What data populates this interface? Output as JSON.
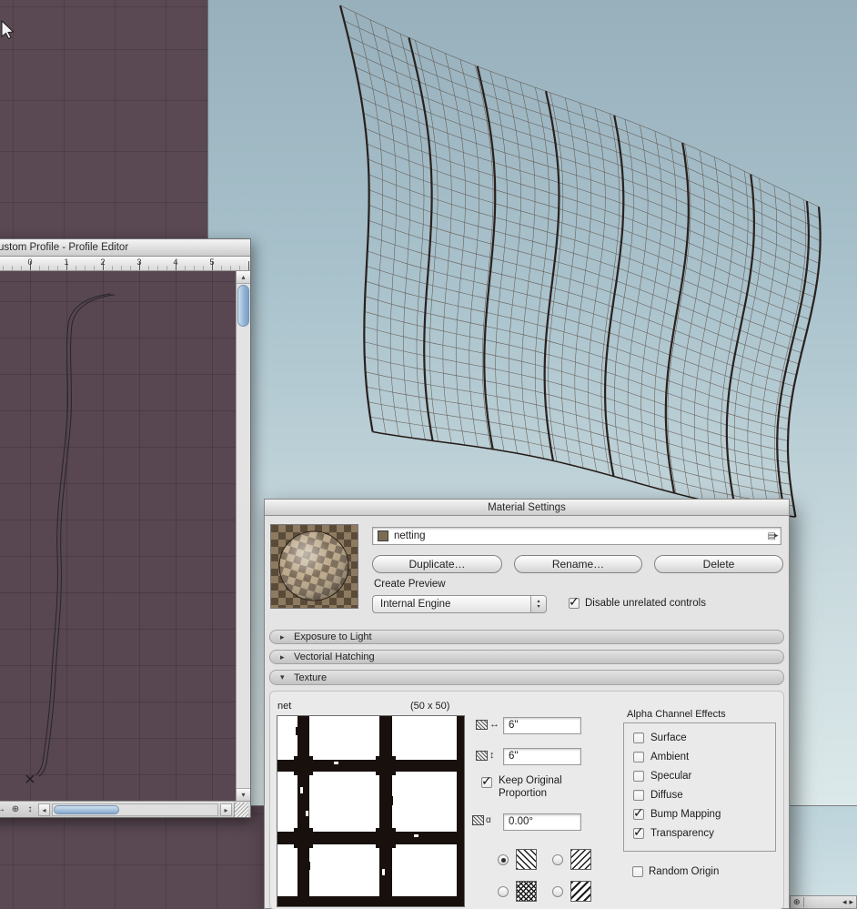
{
  "colors": {
    "workspace_bg": "#5a4852",
    "viewport_top": "#97b0bc",
    "viewport_bottom": "#dce9ea",
    "mesh_line": "#241a16",
    "dialog_bg": "#e4e4e4"
  },
  "icons": {
    "zoom_out": "⊖",
    "zoom_in": "⊕",
    "pan": "↔",
    "fit": "↕",
    "zoom": "⊕",
    "scroll_up": "▴",
    "scroll_down": "▾",
    "scroll_left": "◂",
    "scroll_right": "▸",
    "popup_up": "▴",
    "popup_down": "▾",
    "page": "▤",
    "more": "▸",
    "disclosure_collapsed": "▸",
    "disclosure_expanded": "▾"
  },
  "profile_editor": {
    "title": "ustom Profile - Profile Editor",
    "ruler": [
      "0",
      "1",
      "2",
      "3",
      "4",
      "5"
    ]
  },
  "material_settings": {
    "title": "Material Settings",
    "material_name": "netting",
    "duplicate_label": "Duplicate…",
    "rename_label": "Rename…",
    "delete_label": "Delete",
    "create_preview_label": "Create Preview",
    "engine_value": "Internal Engine",
    "disable_unrelated_label": "Disable unrelated controls",
    "disable_unrelated_checked": true,
    "sections": [
      {
        "label": "Exposure to Light",
        "expanded": false
      },
      {
        "label": "Vectorial Hatching",
        "expanded": false
      },
      {
        "label": "Texture",
        "expanded": true
      }
    ],
    "texture": {
      "file_name": "net",
      "dimensions": "(50 x 50)",
      "width_value": "6\"",
      "height_value": "6\"",
      "keep_line1": "Keep Original",
      "keep_line2": "Proportion",
      "keep_checked": true,
      "angle_value": "0.00°",
      "mirror_options": [
        {
          "selected": true
        },
        {
          "selected": false
        },
        {
          "selected": false
        },
        {
          "selected": false
        }
      ],
      "alpha_title": "Alpha Channel Effects",
      "alpha_options": [
        {
          "label": "Surface",
          "checked": false
        },
        {
          "label": "Ambient",
          "checked": false
        },
        {
          "label": "Specular",
          "checked": false
        },
        {
          "label": "Diffuse",
          "checked": false
        },
        {
          "label": "Bump Mapping",
          "checked": true
        },
        {
          "label": "Transparency",
          "checked": true
        }
      ],
      "random_origin_label": "Random Origin",
      "random_origin_checked": false
    }
  }
}
